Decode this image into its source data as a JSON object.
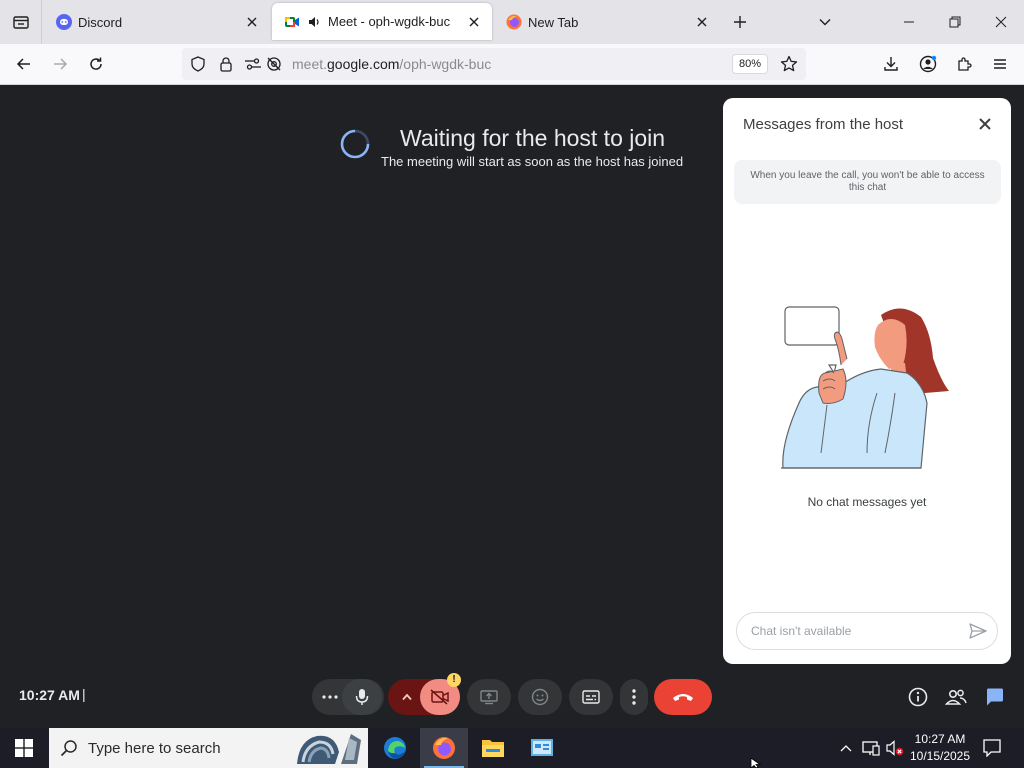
{
  "browser": {
    "tabs": [
      {
        "label": "Discord",
        "icon": "discord-icon",
        "active": false
      },
      {
        "label": "Meet - oph-wgdk-buc",
        "icon": "google-meet-icon",
        "audio": true,
        "active": true
      },
      {
        "label": "New Tab",
        "icon": "firefox-icon",
        "active": false
      }
    ],
    "url_prefix": "meet.",
    "url_domain": "google.com",
    "url_path": "/oph-wgdk-buc",
    "zoom": "80%"
  },
  "meet": {
    "wait_title": "Waiting for the host to join",
    "wait_subtitle": "The meeting will start as soon as the host has joined",
    "clock": "10:27 AM",
    "clock_separator": "|",
    "camera_warning": "!",
    "panel": {
      "title": "Messages from the host",
      "notice": "When you leave the call, you won't be able to access this chat",
      "empty_text": "No chat messages yet",
      "input_placeholder": "Chat isn't available"
    },
    "colors": {
      "end_call": "#ea4335",
      "accent": "#8ab4f8",
      "camera_off": "#6b1414"
    }
  },
  "taskbar": {
    "search_placeholder": "Type here to search",
    "time": "10:27 AM",
    "date": "10/15/2025",
    "apps": [
      "edge-icon",
      "firefox-icon",
      "file-explorer-icon",
      "control-panel-icon"
    ]
  }
}
